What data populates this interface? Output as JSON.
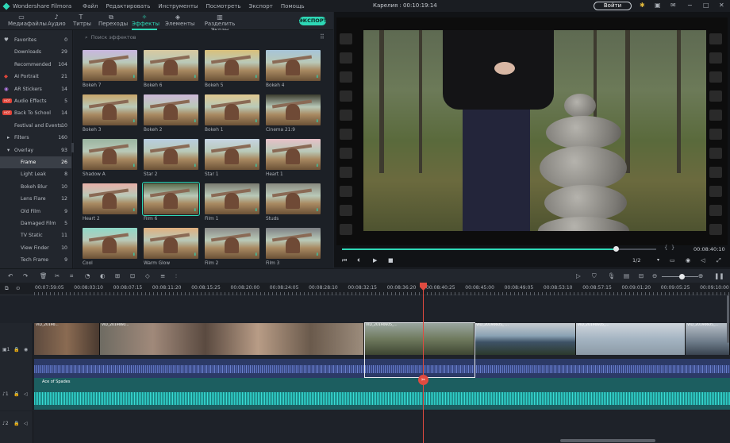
{
  "titlebar": {
    "app_name": "Wondershare Filmora",
    "menu": [
      "Файл",
      "Редактировать",
      "Инструменты",
      "Посмотреть",
      "Экспорт",
      "Помощь"
    ],
    "document_title": "Карелия : 00:10:19:14",
    "login_label": "Войти",
    "icons": [
      "bulb-icon",
      "save-icon",
      "mail-icon",
      "minimize-icon",
      "maximize-icon",
      "close-icon"
    ]
  },
  "toolbar": {
    "tabs": [
      {
        "label": "Медиафайлы",
        "icon": "folder-icon"
      },
      {
        "label": "Аудио",
        "icon": "music-icon"
      },
      {
        "label": "Титры",
        "icon": "title-icon"
      },
      {
        "label": "Переходы",
        "icon": "transition-icon"
      },
      {
        "label": "Эффекты",
        "icon": "effects-icon",
        "active": true
      },
      {
        "label": "Элементы",
        "icon": "elements-icon"
      },
      {
        "label": "Разделить Экран",
        "icon": "split-screen-icon"
      }
    ],
    "export_label": "ЭКСПОРТ",
    "accent_color": "#2ed8b6"
  },
  "sidebar": {
    "items": [
      {
        "label": "Favorites",
        "count": "0",
        "icon": "heart-icon"
      },
      {
        "label": "Downloads",
        "count": "29"
      },
      {
        "label": "Recommended",
        "count": "104"
      },
      {
        "label": "AI Portrait",
        "count": "21",
        "icon": "ai-icon"
      },
      {
        "label": "AR Stickers",
        "count": "14",
        "icon": "ar-icon"
      },
      {
        "label": "Audio Effects",
        "count": "5",
        "badge": "HOT"
      },
      {
        "label": "Back To School",
        "count": "14",
        "badge": "HOT"
      },
      {
        "label": "Festival and Events",
        "count": "10"
      },
      {
        "label": "Filters",
        "count": "160",
        "expand": "▸"
      },
      {
        "label": "Overlay",
        "count": "93",
        "expand": "▾"
      },
      {
        "label": "Frame",
        "count": "26",
        "active": true,
        "sub": true
      },
      {
        "label": "Light Leak",
        "count": "8",
        "sub": true
      },
      {
        "label": "Bokeh Blur",
        "count": "10",
        "sub": true
      },
      {
        "label": "Lens Flare",
        "count": "12",
        "sub": true
      },
      {
        "label": "Old Film",
        "count": "9",
        "sub": true
      },
      {
        "label": "Damaged Film",
        "count": "5",
        "sub": true
      },
      {
        "label": "TV Static",
        "count": "11",
        "sub": true
      },
      {
        "label": "View Finder",
        "count": "10",
        "sub": true
      },
      {
        "label": "Tech Frame",
        "count": "9",
        "sub": true
      }
    ]
  },
  "effects_panel": {
    "search_placeholder": "Поиск эффектов",
    "effects": [
      "Bokeh 7",
      "Bokeh 6",
      "Bokeh 5",
      "Bokeh 4",
      "Bokeh 3",
      "Bokeh 2",
      "Bokeh 1",
      "Cinema 21:9",
      "Shadow A",
      "Star 2",
      "Star 1",
      "Heart 1",
      "Heart 2",
      "Film 6",
      "Film 1",
      "Studs",
      "Cool",
      "Warm Glow",
      "Film 2",
      "Film 3"
    ],
    "selected_effect": "Film 6"
  },
  "preview": {
    "time": "00:08:40:10",
    "ratio": "1/2",
    "playback_progress": 0.87
  },
  "timeline": {
    "ruler_labels": [
      "00:07:59:05",
      "00:08:03:10",
      "00:08:07:15",
      "00:08:11:20",
      "00:08:15:25",
      "00:08:20:00",
      "00:08:24:05",
      "00:08:28:10",
      "00:08:32:15",
      "00:08:36:20",
      "00:08:40:25",
      "00:08:45:00",
      "00:08:49:05",
      "00:08:53:10",
      "00:08:57:15",
      "00:09:01:20",
      "00:09:05:25",
      "00:09:10:00"
    ],
    "video_clips": [
      {
        "title": "VID_20190..."
      },
      {
        "title": "VID_2019060..."
      },
      {
        "title": "VID_20190605_..."
      },
      {
        "title": "VID_20190605_ ..."
      },
      {
        "title": "VID_20190605_..."
      },
      {
        "title": "VID_20190605_..."
      }
    ],
    "audio_title": "Ace of Spades",
    "audio_color": "#1c5e60"
  }
}
